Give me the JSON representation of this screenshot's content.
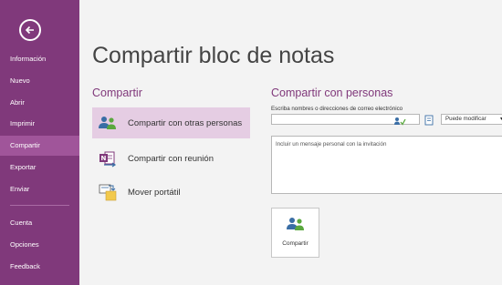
{
  "sidebar": {
    "back_icon": "back-arrow-icon",
    "items": [
      {
        "label": "Información",
        "active": false
      },
      {
        "label": "Nuevo",
        "active": false
      },
      {
        "label": "Abrir",
        "active": false
      },
      {
        "label": "Imprimir",
        "active": false
      },
      {
        "label": "Compartir",
        "active": true
      },
      {
        "label": "Exportar",
        "active": false
      },
      {
        "label": "Enviar",
        "active": false
      }
    ],
    "bottom_items": [
      {
        "label": "Cuenta"
      },
      {
        "label": "Opciones"
      },
      {
        "label": "Feedback"
      }
    ],
    "colors": {
      "background": "#80397b",
      "active": "#a0559a"
    }
  },
  "main": {
    "title": "Compartir bloc de notas",
    "share_section": {
      "title": "Compartir",
      "options": [
        {
          "label": "Compartir con otras personas",
          "icon": "people-icon",
          "active": true
        },
        {
          "label": "Compartir con reunión",
          "icon": "onenote-meeting-icon",
          "active": false
        },
        {
          "label": "Mover portátil",
          "icon": "move-notebook-icon",
          "active": false
        }
      ]
    },
    "people_section": {
      "title": "Compartir con personas",
      "names_label": "Escriba nombres o direcciones de correo electrónico",
      "names_value": "",
      "permission": "Puede modificar",
      "message_placeholder": "Incluir un mensaje personal con la invitación",
      "share_button": "Compartir"
    },
    "accent_color": "#80397b"
  }
}
